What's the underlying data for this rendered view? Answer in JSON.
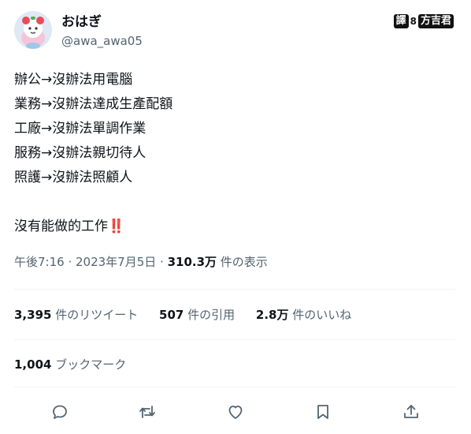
{
  "author": {
    "name": "おはぎ",
    "handle": "@awa_awa05"
  },
  "watermark": {
    "left": "譯",
    "sep": "8",
    "right": "方吉君"
  },
  "tweet": {
    "lines": [
      "辦公→沒辦法用電腦",
      "業務→沒辦法達成生產配額",
      "工廠→沒辦法單調作業",
      "服務→沒辦法親切待人",
      "照護→沒辦法照顧人"
    ],
    "closing": "沒有能做的工作",
    "closing_emoji": "‼️"
  },
  "meta": {
    "time": "午後7:16",
    "separator": " · ",
    "date": "2023年7月5日",
    "views_count": "310.3万",
    "views_label": " 件の表示"
  },
  "stats": {
    "retweets_count": "3,395",
    "retweets_label": " 件のリツイート",
    "quotes_count": "507",
    "quotes_label": " 件の引用",
    "likes_count": "2.8万",
    "likes_label": " 件のいいね"
  },
  "bookmarks": {
    "count": "1,004",
    "label": " ブックマーク"
  },
  "actions": [
    "reply-icon",
    "retweet-icon",
    "like-icon",
    "bookmark-icon",
    "share-icon"
  ],
  "colors": {
    "text": "#0f1419",
    "secondary": "#536471",
    "divider": "#eff3f4",
    "emoji_red": "#d0021b"
  }
}
